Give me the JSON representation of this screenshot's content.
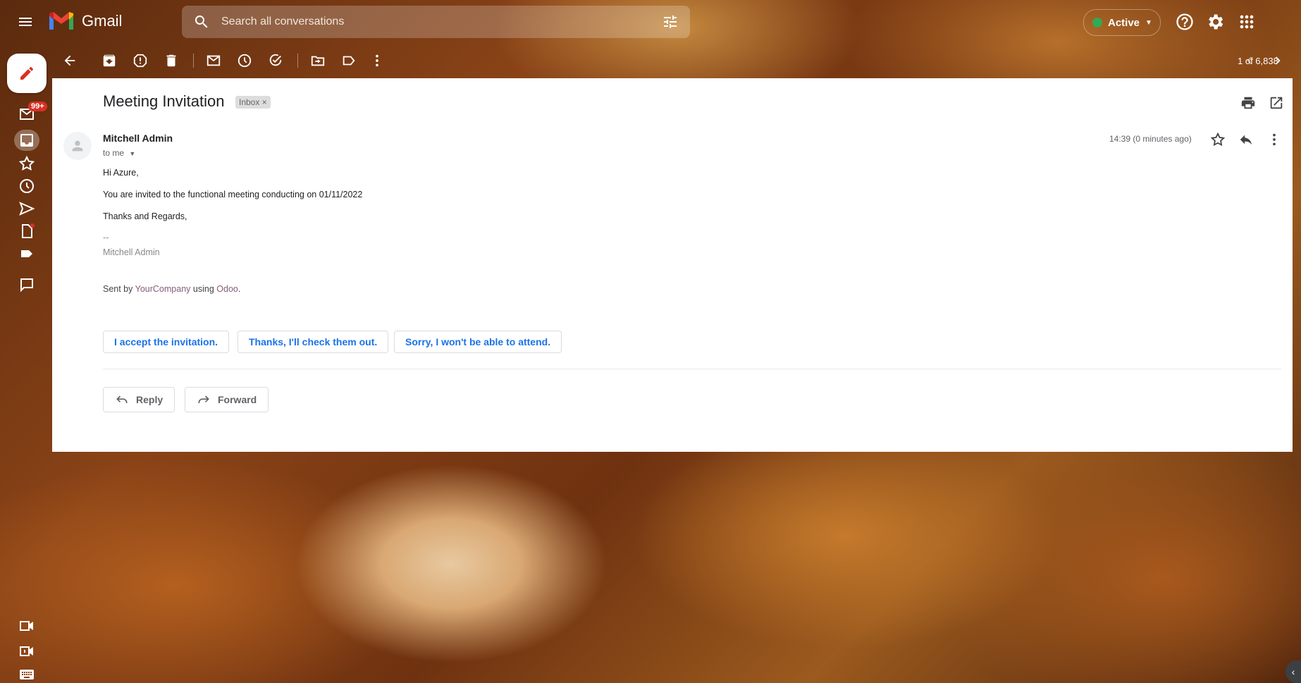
{
  "app": {
    "name": "Gmail"
  },
  "search": {
    "placeholder": "Search all conversations"
  },
  "status": {
    "label": "Active",
    "color": "#34a853"
  },
  "toolbar": {
    "pager": "1 of 6,838"
  },
  "rail": {
    "badge": "99+"
  },
  "message": {
    "subject": "Meeting Invitation",
    "label_chip": "Inbox",
    "label_close": "×",
    "sender": "Mitchell Admin",
    "to": "to me",
    "timestamp": "14:39 (0 minutes ago)",
    "greeting": "Hi Azure,",
    "line1": "You are invited to the functional meeting conducting on 01/11/2022",
    "closing": "Thanks and Regards,",
    "sig_dash": "--",
    "sig_name": "Mitchell Admin",
    "sent_prefix": "Sent by",
    "company": "YourCompany",
    "using": "using",
    "odoo": "Odoo",
    "period": "."
  },
  "quick_replies": [
    "I accept the invitation.",
    "Thanks, I'll check them out.",
    "Sorry, I won't be able to attend."
  ],
  "actions": {
    "reply": "Reply",
    "forward": "Forward"
  },
  "colors": {
    "accent_blue": "#1a73e8",
    "badge_red": "#d93025",
    "link_purple": "#875a7b"
  }
}
